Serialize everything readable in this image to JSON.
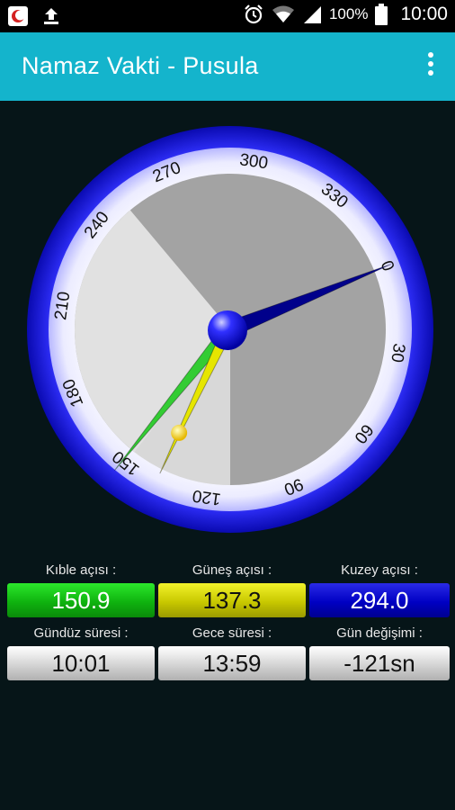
{
  "status_bar": {
    "battery_percent": "100%",
    "time": "10:00",
    "icons": [
      "app-notification-icon",
      "upload-icon",
      "alarm-icon",
      "wifi-icon",
      "signal-icon",
      "battery-icon"
    ]
  },
  "app_bar": {
    "title": "Namaz Vakti - Pusula",
    "menu_icon": "overflow-menu-icon"
  },
  "compass": {
    "ring_labels": [
      "0",
      "30",
      "60",
      "90",
      "120",
      "150",
      "180",
      "210",
      "240",
      "270",
      "300",
      "330"
    ],
    "kible_angle": 150.9,
    "gunes_angle": 137.3,
    "kuzey_angle": 294.0,
    "colors": {
      "ring": "#1010d8",
      "kible": "#33cc33",
      "gunes": "#e6e600",
      "kuzey": "#00008b"
    }
  },
  "readouts": {
    "kible": {
      "label": "Kıble açısı :",
      "value": "150.9"
    },
    "gunes": {
      "label": "Güneş açısı :",
      "value": "137.3"
    },
    "kuzey": {
      "label": "Kuzey açısı :",
      "value": "294.0"
    },
    "gunduz": {
      "label": "Gündüz süresi :",
      "value": "10:01"
    },
    "gece": {
      "label": "Gece süresi :",
      "value": "13:59"
    },
    "gun_degisimi": {
      "label": "Gün değişimi :",
      "value": "-121sn"
    }
  }
}
